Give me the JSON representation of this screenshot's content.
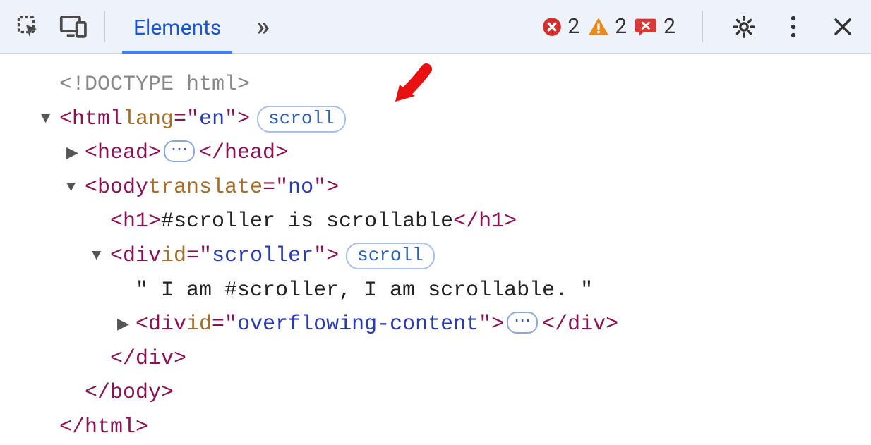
{
  "toolbar": {
    "tabs": {
      "elements": "Elements"
    },
    "more_tabs_glyph": "»",
    "counts": {
      "errors": "2",
      "warnings": "2",
      "issues": "2"
    }
  },
  "dom": {
    "doctype": "<!DOCTYPE html>",
    "html_open_pre": "<",
    "html_tag": "html",
    "html_space": " ",
    "html_attr_name": "lang",
    "html_attr_eq": "=\"",
    "html_attr_val": "en",
    "html_attr_close": "\">",
    "scroll_badge": "scroll",
    "head_open_pre": "<",
    "head_tag": "head",
    "head_open_post": ">",
    "ellipsis": "⋯",
    "head_close": "</head>",
    "body_open_pre": "<",
    "body_tag": "body",
    "body_space": " ",
    "body_attr_name": "translate",
    "body_attr_eq": "=\"",
    "body_attr_val": "no",
    "body_attr_close": "\">",
    "h1_open": "<h1>",
    "h1_text": "#scroller is scrollable",
    "h1_close": "</h1>",
    "div1_open_pre": "<",
    "div1_tag": "div",
    "div1_space": " ",
    "div1_attr_name": "id",
    "div1_attr_eq": "=\"",
    "div1_attr_val": "scroller",
    "div1_attr_close": "\">",
    "text_node": "\" I am #scroller, I am scrollable. \"",
    "div2_open_pre": "<",
    "div2_tag": "div",
    "div2_space": " ",
    "div2_attr_name": "id",
    "div2_attr_eq": "=\"",
    "div2_attr_val": "overflowing-content",
    "div2_attr_close": "\">",
    "div2_close": "</div>",
    "div1_close": "</div>",
    "body_close": "</body>",
    "html_close": "</html>"
  }
}
